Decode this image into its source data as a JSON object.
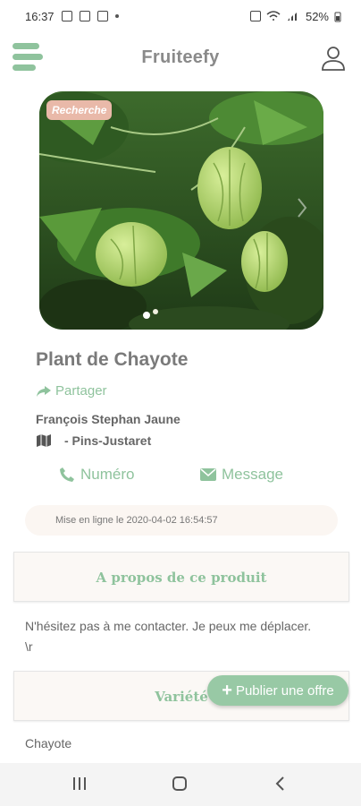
{
  "status_bar": {
    "time": "16:37",
    "battery": "52%"
  },
  "header": {
    "title": "Fruiteefy"
  },
  "product": {
    "badge": "Recherche",
    "title": "Plant de Chayote",
    "share_label": "Partager",
    "seller": "François Stephan Jaune",
    "location": "- Pins-Justaret",
    "call_label": "Numéro",
    "message_label": "Message",
    "posted": "Mise en ligne le 2020-04-02 16:54:57"
  },
  "about": {
    "heading": "A propos de ce produit",
    "description": "N'hésitez pas à me contacter. Je peux me déplacer. \\r"
  },
  "variety": {
    "heading": "Variété",
    "value": "Chayote"
  },
  "fab": {
    "label": "Publier une offre"
  },
  "colors": {
    "accent": "#8fc39d",
    "badge": "#e9b9a9"
  }
}
